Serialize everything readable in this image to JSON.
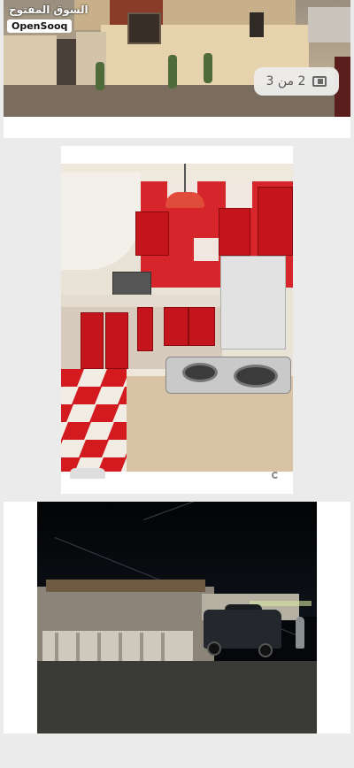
{
  "listing_gallery": {
    "brand": {
      "arabic_name": "السوق المفتوح",
      "latin_name": "OpenSooq"
    },
    "image_counter": {
      "text": "2 من 3",
      "icon": "gallery-icon"
    },
    "photos": [
      {
        "subject": "house-exterior"
      },
      {
        "subject": "red-kitchen"
      },
      {
        "subject": "night-exterior-with-truck"
      }
    ]
  },
  "colors": {
    "page_background": "#ebebeb",
    "card_background": "#ffffff",
    "kitchen_red": "#c5151c"
  }
}
